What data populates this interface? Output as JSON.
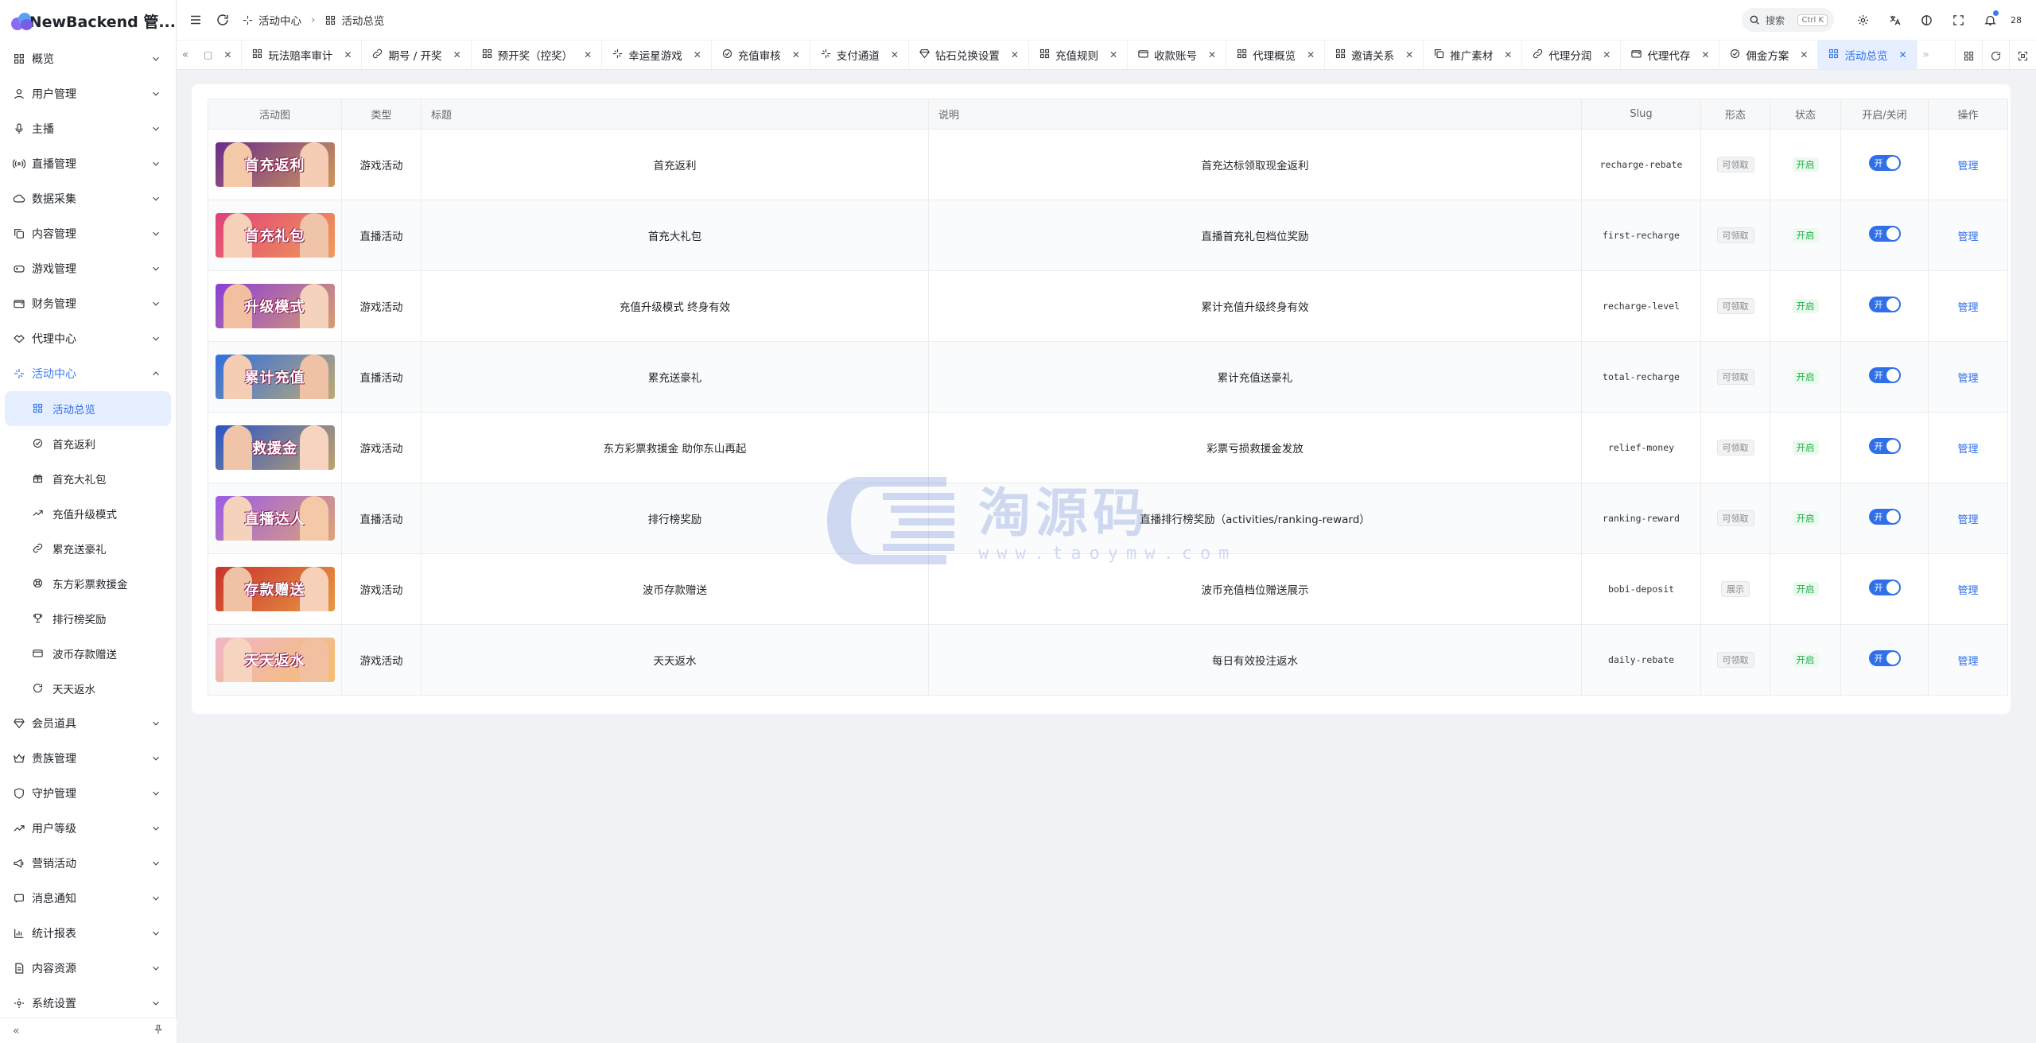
{
  "app": {
    "title": "NewBackend 管...",
    "brand_color": "#3a7cf0"
  },
  "sidebar": {
    "items": [
      {
        "label": "概览",
        "icon": "grid-icon"
      },
      {
        "label": "用户管理",
        "icon": "user-icon"
      },
      {
        "label": "主播",
        "icon": "mic-icon"
      },
      {
        "label": "直播管理",
        "icon": "broadcast-icon"
      },
      {
        "label": "数据采集",
        "icon": "cloud-icon"
      },
      {
        "label": "内容管理",
        "icon": "copy-icon"
      },
      {
        "label": "游戏管理",
        "icon": "gamepad-icon"
      },
      {
        "label": "财务管理",
        "icon": "wallet-icon"
      },
      {
        "label": "代理中心",
        "icon": "handshake-icon"
      },
      {
        "label": "活动中心",
        "icon": "sparkle-icon"
      }
    ],
    "sub_items": [
      {
        "label": "活动总览",
        "icon": "grid-icon"
      },
      {
        "label": "首充返利",
        "icon": "check-circle-icon"
      },
      {
        "label": "首充大礼包",
        "icon": "gift-icon"
      },
      {
        "label": "充值升级模式",
        "icon": "trend-icon"
      },
      {
        "label": "累充送豪礼",
        "icon": "link-icon"
      },
      {
        "label": "东方彩票救援金",
        "icon": "lifebuoy-icon"
      },
      {
        "label": "排行榜奖励",
        "icon": "trophy-icon"
      },
      {
        "label": "波币存款赠送",
        "icon": "card-icon"
      },
      {
        "label": "天天返水",
        "icon": "refresh-icon"
      }
    ],
    "items_after": [
      {
        "label": "会员道具",
        "icon": "diamond-icon"
      },
      {
        "label": "贵族管理",
        "icon": "crown-icon"
      },
      {
        "label": "守护管理",
        "icon": "shield-icon"
      },
      {
        "label": "用户等级",
        "icon": "trend-icon"
      },
      {
        "label": "营销活动",
        "icon": "megaphone-icon"
      },
      {
        "label": "消息通知",
        "icon": "message-icon"
      },
      {
        "label": "统计报表",
        "icon": "chart-icon"
      },
      {
        "label": "内容资源",
        "icon": "file-icon"
      },
      {
        "label": "系统设置",
        "icon": "settings-icon"
      }
    ]
  },
  "header": {
    "breadcrumb": [
      "活动中心",
      "活动总览"
    ],
    "search_label": "搜索",
    "search_shortcut": "Ctrl K",
    "avatar_text": "28"
  },
  "tabs": [
    {
      "label": "",
      "partial": true
    },
    {
      "label": "玩法赔率审计"
    },
    {
      "label": "期号 / 开奖"
    },
    {
      "label": "预开奖（控奖）"
    },
    {
      "label": "幸运星游戏"
    },
    {
      "label": "充值审核"
    },
    {
      "label": "支付通道"
    },
    {
      "label": "钻石兑换设置"
    },
    {
      "label": "充值规则"
    },
    {
      "label": "收款账号"
    },
    {
      "label": "代理概览"
    },
    {
      "label": "邀请关系"
    },
    {
      "label": "推广素材"
    },
    {
      "label": "代理分润"
    },
    {
      "label": "代理代存"
    },
    {
      "label": "佣金方案"
    },
    {
      "label": "活动总览",
      "active": true
    }
  ],
  "table": {
    "headers": [
      "活动图",
      "类型",
      "标题",
      "说明",
      "Slug",
      "形态",
      "状态",
      "开启/关闭",
      "操作"
    ],
    "rows": [
      {
        "banner": "首充返利",
        "type": "游戏活动",
        "title": "首充返利",
        "desc": "首充达标领取现金返利",
        "slug": "recharge-rebate",
        "form": "可领取",
        "status": "开启",
        "toggle": "开",
        "action": "管理"
      },
      {
        "banner": "首充礼包",
        "type": "直播活动",
        "title": "首充大礼包",
        "desc": "直播首充礼包档位奖励",
        "slug": "first-recharge",
        "form": "可领取",
        "status": "开启",
        "toggle": "开",
        "action": "管理"
      },
      {
        "banner": "升级模式",
        "type": "游戏活动",
        "title": "充值升级模式 终身有效",
        "desc": "累计充值升级终身有效",
        "slug": "recharge-level",
        "form": "可领取",
        "status": "开启",
        "toggle": "开",
        "action": "管理"
      },
      {
        "banner": "累计充值",
        "type": "直播活动",
        "title": "累充送豪礼",
        "desc": "累计充值送豪礼",
        "slug": "total-recharge",
        "form": "可领取",
        "status": "开启",
        "toggle": "开",
        "action": "管理"
      },
      {
        "banner": "救援金",
        "type": "游戏活动",
        "title": "东方彩票救援金 助你东山再起",
        "desc": "彩票亏损救援金发放",
        "slug": "relief-money",
        "form": "可领取",
        "status": "开启",
        "toggle": "开",
        "action": "管理"
      },
      {
        "banner": "直播达人",
        "type": "直播活动",
        "title": "排行榜奖励",
        "desc": "直播排行榜奖励（activities/ranking-reward）",
        "slug": "ranking-reward",
        "form": "可领取",
        "status": "开启",
        "toggle": "开",
        "action": "管理"
      },
      {
        "banner": "存款赠送",
        "type": "游戏活动",
        "title": "波币存款赠送",
        "desc": "波币充值档位赠送展示",
        "slug": "bobi-deposit",
        "form": "展示",
        "status": "开启",
        "toggle": "开",
        "action": "管理"
      },
      {
        "banner": "天天返水",
        "type": "游戏活动",
        "title": "天天返水",
        "desc": "每日有效投注返水",
        "slug": "daily-rebate",
        "form": "可领取",
        "status": "开启",
        "toggle": "开",
        "action": "管理"
      }
    ]
  },
  "banner_colors": [
    "#6a2c8a",
    "#e0407a",
    "#8a3fd6",
    "#2f6fe0",
    "#2a55c8",
    "#9b5be8",
    "#c8322c",
    "#f0b6c8"
  ],
  "watermark": {
    "text": "淘源码",
    "url": "www.taoymw.com"
  }
}
